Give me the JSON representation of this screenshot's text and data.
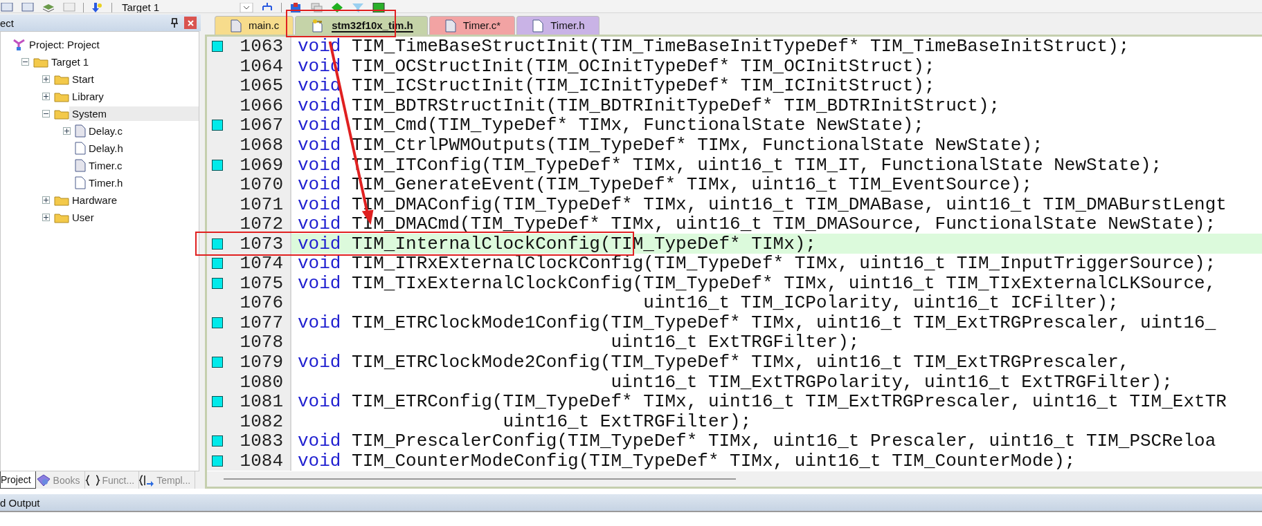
{
  "toolbar": {
    "target": "Target 1"
  },
  "project_panel": {
    "title": "ect",
    "tree": [
      {
        "label": "Project: Project",
        "kind": "project",
        "selected": false,
        "children": [
          {
            "label": "Target 1",
            "kind": "target",
            "selected": false,
            "expanded": true,
            "children": [
              {
                "label": "Start",
                "kind": "folder",
                "selected": false,
                "expanded": false
              },
              {
                "label": "Library",
                "kind": "folder",
                "selected": false,
                "expanded": false
              },
              {
                "label": "System",
                "kind": "folder",
                "selected": true,
                "expanded": true,
                "children": [
                  {
                    "label": "Delay.c",
                    "kind": "source",
                    "selected": false,
                    "expanded": false
                  },
                  {
                    "label": "Delay.h",
                    "kind": "header",
                    "selected": false
                  },
                  {
                    "label": "Timer.c",
                    "kind": "source",
                    "selected": false
                  },
                  {
                    "label": "Timer.h",
                    "kind": "header",
                    "selected": false
                  }
                ]
              },
              {
                "label": "Hardware",
                "kind": "folder",
                "selected": false,
                "expanded": false
              },
              {
                "label": "User",
                "kind": "folder",
                "selected": false,
                "expanded": false
              }
            ]
          }
        ]
      }
    ],
    "tabs": [
      {
        "label": "Project",
        "kind": "project",
        "selected": true
      },
      {
        "label": "Books",
        "kind": "books",
        "selected": false
      },
      {
        "label": "Funct...",
        "kind": "functions",
        "selected": false
      },
      {
        "label": "Templ...",
        "kind": "templates",
        "selected": false
      }
    ]
  },
  "editor_tabs": [
    {
      "label": "main.c",
      "kind": "source",
      "color": "#f7dc8c",
      "selected": false
    },
    {
      "label": "stm32f10x_tim.h",
      "kind": "readonly",
      "color": "#c5d3a8",
      "selected": true
    },
    {
      "label": "Timer.c*",
      "kind": "source",
      "color": "#f2a3a3",
      "selected": false
    },
    {
      "label": "Timer.h",
      "kind": "header",
      "color": "#c9b3e6",
      "selected": false
    }
  ],
  "code": [
    {
      "number": "1063",
      "marker": true,
      "highlighted": false,
      "keyword": "void",
      "text": " TIM_TimeBaseStructInit(TIM_TimeBaseInitTypeDef* TIM_TimeBaseInitStruct);"
    },
    {
      "number": "1064",
      "marker": false,
      "highlighted": false,
      "keyword": "void",
      "text": " TIM_OCStructInit(TIM_OCInitTypeDef* TIM_OCInitStruct);"
    },
    {
      "number": "1065",
      "marker": false,
      "highlighted": false,
      "keyword": "void",
      "text": " TIM_ICStructInit(TIM_ICInitTypeDef* TIM_ICInitStruct);"
    },
    {
      "number": "1066",
      "marker": false,
      "highlighted": false,
      "keyword": "void",
      "text": " TIM_BDTRStructInit(TIM_BDTRInitTypeDef* TIM_BDTRInitStruct);"
    },
    {
      "number": "1067",
      "marker": true,
      "highlighted": false,
      "keyword": "void",
      "text": " TIM_Cmd(TIM_TypeDef* TIMx, FunctionalState NewState);"
    },
    {
      "number": "1068",
      "marker": false,
      "highlighted": false,
      "keyword": "void",
      "text": " TIM_CtrlPWMOutputs(TIM_TypeDef* TIMx, FunctionalState NewState);"
    },
    {
      "number": "1069",
      "marker": true,
      "highlighted": false,
      "keyword": "void",
      "text": " TIM_ITConfig(TIM_TypeDef* TIMx, uint16_t TIM_IT, FunctionalState NewState);"
    },
    {
      "number": "1070",
      "marker": false,
      "highlighted": false,
      "keyword": "void",
      "text": " TIM_GenerateEvent(TIM_TypeDef* TIMx, uint16_t TIM_EventSource);"
    },
    {
      "number": "1071",
      "marker": false,
      "highlighted": false,
      "keyword": "void",
      "text": " TIM_DMAConfig(TIM_TypeDef* TIMx, uint16_t TIM_DMABase, uint16_t TIM_DMABurstLengt"
    },
    {
      "number": "1072",
      "marker": false,
      "highlighted": false,
      "keyword": "void",
      "text": " TIM_DMACmd(TIM_TypeDef* TIMx, uint16_t TIM_DMASource, FunctionalState NewState);"
    },
    {
      "number": "1073",
      "marker": true,
      "highlighted": true,
      "keyword": "void",
      "text": " TIM_InternalClockConfig(TIM_TypeDef* TIMx);"
    },
    {
      "number": "1074",
      "marker": true,
      "highlighted": false,
      "keyword": "void",
      "text": " TIM_ITRxExternalClockConfig(TIM_TypeDef* TIMx, uint16_t TIM_InputTriggerSource);"
    },
    {
      "number": "1075",
      "marker": true,
      "highlighted": false,
      "keyword": "void",
      "text": " TIM_TIxExternalClockConfig(TIM_TypeDef* TIMx, uint16_t TIM_TIxExternalCLKSource,"
    },
    {
      "number": "1076",
      "marker": false,
      "highlighted": false,
      "text": "                                uint16_t TIM_ICPolarity, uint16_t ICFilter);"
    },
    {
      "number": "1077",
      "marker": true,
      "highlighted": false,
      "keyword": "void",
      "text": " TIM_ETRClockMode1Config(TIM_TypeDef* TIMx, uint16_t TIM_ExtTRGPrescaler, uint16_"
    },
    {
      "number": "1078",
      "marker": false,
      "highlighted": false,
      "text": "                             uint16_t ExtTRGFilter);"
    },
    {
      "number": "1079",
      "marker": true,
      "highlighted": false,
      "keyword": "void",
      "text": " TIM_ETRClockMode2Config(TIM_TypeDef* TIMx, uint16_t TIM_ExtTRGPrescaler,"
    },
    {
      "number": "1080",
      "marker": false,
      "highlighted": false,
      "text": "                             uint16_t TIM_ExtTRGPolarity, uint16_t ExtTRGFilter);"
    },
    {
      "number": "1081",
      "marker": true,
      "highlighted": false,
      "keyword": "void",
      "text": " TIM_ETRConfig(TIM_TypeDef* TIMx, uint16_t TIM_ExtTRGPrescaler, uint16_t TIM_ExtTR"
    },
    {
      "number": "1082",
      "marker": false,
      "highlighted": false,
      "text": "                   uint16_t ExtTRGFilter);"
    },
    {
      "number": "1083",
      "marker": true,
      "highlighted": false,
      "keyword": "void",
      "text": " TIM_PrescalerConfig(TIM_TypeDef* TIMx, uint16_t Prescaler, uint16_t TIM_PSCReloa"
    },
    {
      "number": "1084",
      "marker": true,
      "highlighted": false,
      "keyword": "void",
      "text": " TIM_CounterModeConfig(TIM_TypeDef* TIMx, uint16_t TIM_CounterMode);"
    }
  ],
  "output_panel": {
    "title": "d Output"
  }
}
